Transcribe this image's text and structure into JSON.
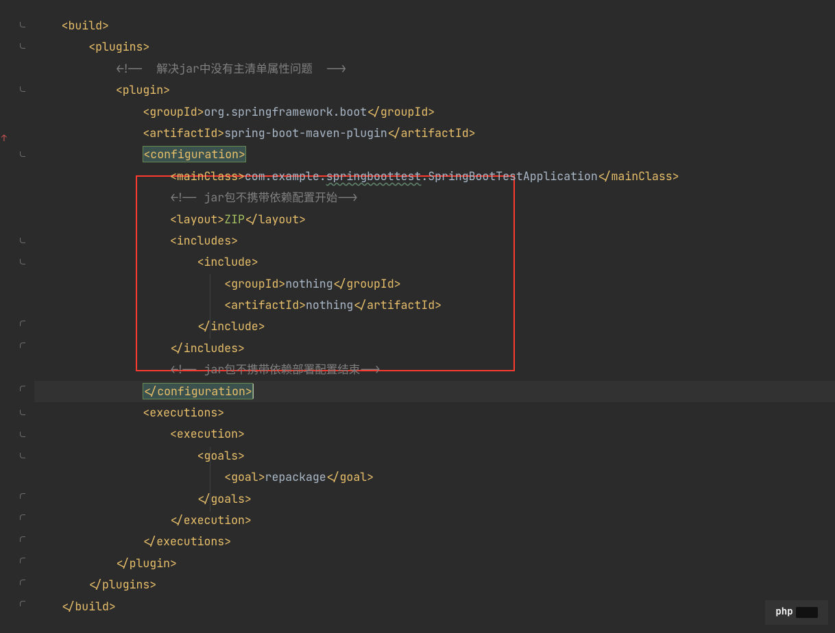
{
  "tags": {
    "build_open": "<build>",
    "build_close": "</build>",
    "plugins_open": "<plugins>",
    "plugins_close": "</plugins>",
    "plugin_open": "<plugin>",
    "plugin_close": "</plugin>",
    "groupId_open": "<groupId>",
    "groupId_close": "</groupId>",
    "artifactId_open": "<artifactId>",
    "artifactId_close": "</artifactId>",
    "configuration_open": "<configuration>",
    "configuration_close": "</configuration>",
    "mainClass_open": "<mainClass>",
    "mainClass_close": "</mainClass>",
    "layout_open": "<layout>",
    "layout_close": "</layout>",
    "includes_open": "<includes>",
    "includes_close": "</includes>",
    "include_open": "<include>",
    "include_close": "</include>",
    "executions_open": "<executions>",
    "executions_close": "</executions>",
    "execution_open": "<execution>",
    "execution_close": "</execution>",
    "goals_open": "<goals>",
    "goals_close": "</goals>",
    "goal_open": "<goal>",
    "goal_close": "</goal>"
  },
  "comments": {
    "c1_open": "<!--  ",
    "c1_text": "解决jar中没有主清单属性问题  ",
    "c1_close": "-->",
    "c2_open": "<!-- jar",
    "c2_text": "包不携带依赖配置开始",
    "c2_close": "-->",
    "c3_open": "<!-- jar",
    "c3_text": "包不携带依赖部署配置结束",
    "c3_close": "-->"
  },
  "values": {
    "groupId_boot": "org.springframework.boot",
    "artifactId_plugin": "spring-boot-maven-plugin",
    "mainClass_pre": "com.example.",
    "mainClass_warn": "springboottest",
    "mainClass_post": ".SpringBootTestApplication",
    "layout": "ZIP",
    "include_group": "nothing",
    "include_artifact": "nothing",
    "goal": "repackage"
  },
  "watermark": {
    "label": "php"
  }
}
